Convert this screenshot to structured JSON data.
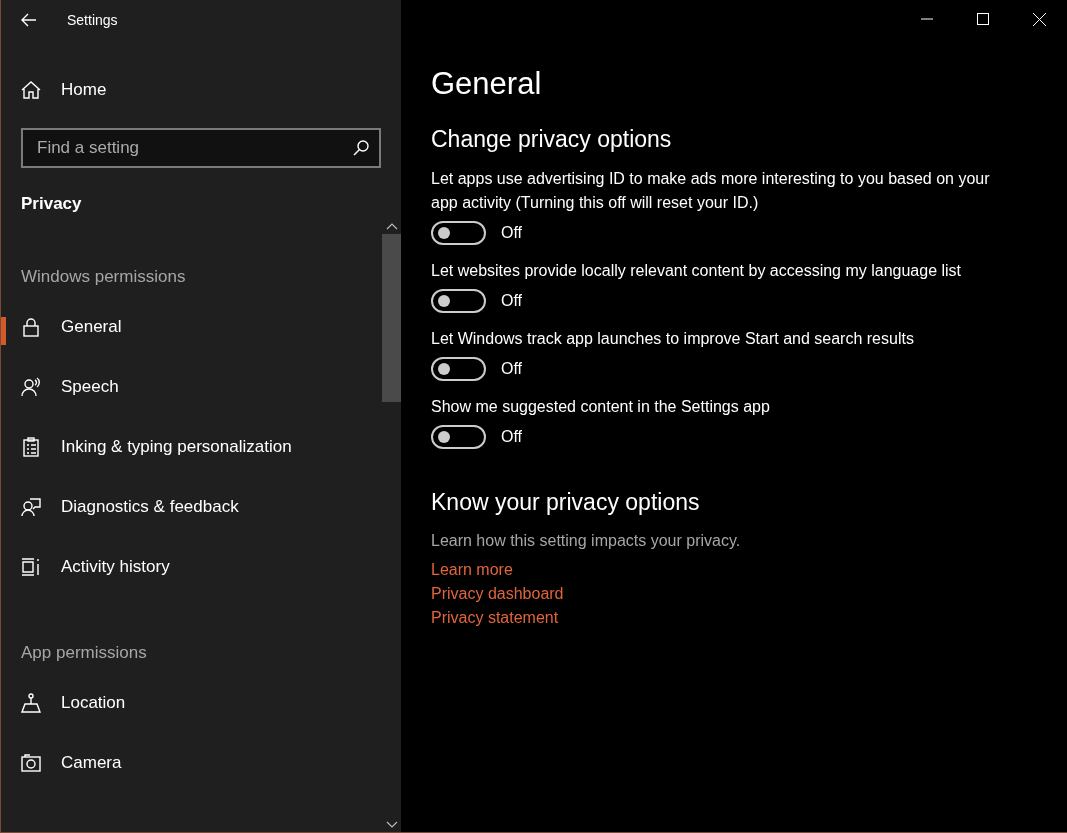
{
  "window": {
    "title": "Settings"
  },
  "sidebar": {
    "home": "Home",
    "search": {
      "placeholder": "Find a setting"
    },
    "category": "Privacy",
    "groups": [
      {
        "heading": "Windows permissions",
        "items": [
          {
            "label": "General",
            "kind": "lock",
            "selected": true
          },
          {
            "label": "Speech",
            "kind": "speech",
            "selected": false
          },
          {
            "label": "Inking & typing personalization",
            "kind": "clipboard",
            "selected": false
          },
          {
            "label": "Diagnostics & feedback",
            "kind": "feedback",
            "selected": false
          },
          {
            "label": "Activity history",
            "kind": "activity",
            "selected": false
          }
        ]
      },
      {
        "heading": "App permissions",
        "items": [
          {
            "label": "Location",
            "kind": "location",
            "selected": false
          },
          {
            "label": "Camera",
            "kind": "camera",
            "selected": false
          }
        ]
      }
    ]
  },
  "content": {
    "title": "General",
    "section": "Change privacy options",
    "toggles": [
      {
        "label": "Let apps use advertising ID to make ads more interesting to you based on your app activity (Turning this off will reset your ID.)",
        "on": false,
        "state_text": "Off"
      },
      {
        "label": "Let websites provide locally relevant content by accessing my language list",
        "on": false,
        "state_text": "Off"
      },
      {
        "label": "Let Windows track app launches to improve Start and search results",
        "on": false,
        "state_text": "Off"
      },
      {
        "label": "Show me suggested content in the Settings app",
        "on": false,
        "state_text": "Off"
      }
    ],
    "know_title": "Know your privacy options",
    "know_text": "Learn how this setting impacts your privacy.",
    "links": [
      "Learn more",
      "Privacy dashboard",
      "Privacy statement"
    ]
  }
}
